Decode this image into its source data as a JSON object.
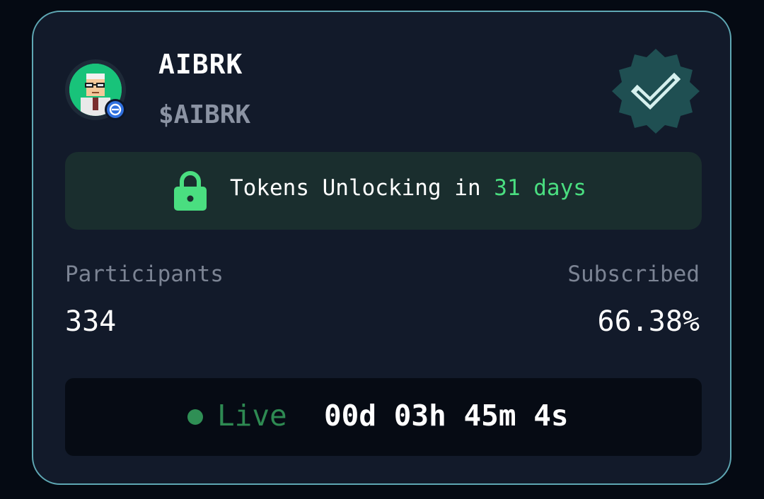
{
  "token": {
    "name": "AIBRK",
    "symbol": "$AIBRK",
    "avatar_icon": "pixel-portrait-avatar",
    "chain_badge_icon": "chain-badge-icon",
    "verified_icon": "verified-badge-icon"
  },
  "unlock": {
    "prefix": "Tokens Unlocking in",
    "days": "31 days",
    "icon": "lock-icon"
  },
  "stats": {
    "participants_label": "Participants",
    "participants_value": "334",
    "subscribed_label": "Subscribed",
    "subscribed_value": "66.38%"
  },
  "status": {
    "live_label": "Live",
    "countdown": "00d 03h 45m 4s"
  },
  "colors": {
    "accent_green": "#4ade80",
    "live_green": "#2e8a52",
    "border": "#5fa8b4",
    "card_bg": "#121a2a",
    "verified_teal": "#1f4f52"
  }
}
